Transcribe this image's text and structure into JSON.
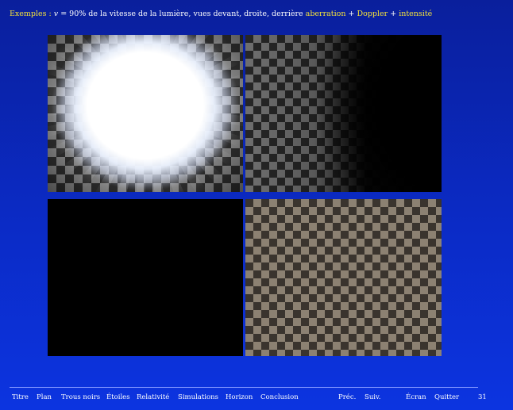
{
  "slide": {
    "title_label": "Exemples :",
    "math_v": "v",
    "title_mid": " = 90% de la vitesse de la lumière, vues devant, droite, derrière ",
    "effect_aberration": "aberration",
    "plus_1": " + ",
    "effect_doppler": "Doppler",
    "plus_2": " + ",
    "effect_intensity": "intensité"
  },
  "panels": [
    {
      "view": "front-view",
      "icon": "starfield-bright-disk-image"
    },
    {
      "view": "right-view",
      "icon": "checkerboard-fading-image"
    },
    {
      "view": "back-view",
      "icon": "black-image"
    },
    {
      "view": "side-view",
      "icon": "checkerboard-image"
    }
  ],
  "nav": {
    "items": [
      "Titre",
      "Plan",
      "Trous noirs",
      "Étoiles",
      "Relativité",
      "Simulations",
      "Horizon",
      "Conclusion"
    ],
    "prev": "Préc.",
    "next": "Suiv.",
    "screen": "Écran",
    "quit": "Quitter",
    "page": "31"
  },
  "colors": {
    "background": "#0b2bc6",
    "highlight": "#f5e23a",
    "text": "#ffffff"
  }
}
